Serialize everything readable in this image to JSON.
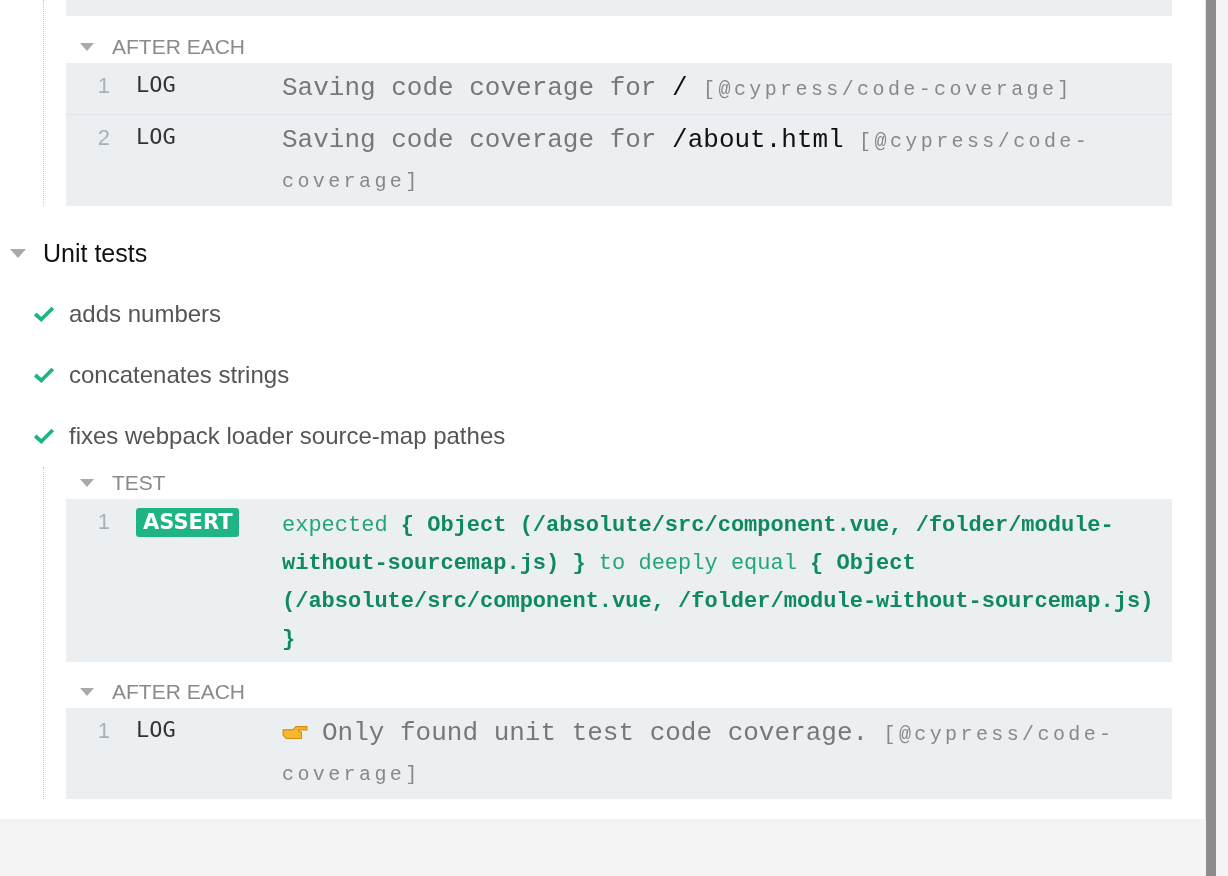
{
  "previous_test": {
    "hooks": [
      {
        "title": "AFTER EACH",
        "expanded": true,
        "commands": [
          {
            "number": "1",
            "name": "LOG",
            "kind": "log",
            "message": [
              {
                "kind": "text",
                "text": "Saving code coverage for "
              },
              {
                "kind": "value",
                "text": "/"
              },
              {
                "kind": "ref",
                "text": " [@cypress/code-coverage]"
              }
            ]
          },
          {
            "number": "2",
            "name": "LOG",
            "kind": "log",
            "message": [
              {
                "kind": "text",
                "text": "Saving code coverage for "
              },
              {
                "kind": "value",
                "text": "/about.html"
              },
              {
                "kind": "ref",
                "text": " [@cypress/code-coverage]"
              }
            ]
          }
        ]
      }
    ]
  },
  "suite": {
    "title": "Unit tests",
    "expanded": true,
    "tests": [
      {
        "title": "adds numbers",
        "passed": true
      },
      {
        "title": "concatenates strings",
        "passed": true
      },
      {
        "title": "fixes webpack loader source-map pathes",
        "passed": true,
        "hooks": [
          {
            "title": "TEST",
            "expanded": true,
            "commands": [
              {
                "number": "1",
                "name": "ASSERT",
                "kind": "assert",
                "message": [
                  {
                    "kind": "text",
                    "text": "expected "
                  },
                  {
                    "kind": "value",
                    "text": " { Object (/absolute/src/component.vue, /folder/module-without-sourcemap.js) } "
                  },
                  {
                    "kind": "text",
                    "text": " to deeply equal "
                  },
                  {
                    "kind": "value",
                    "text": " { Object (/absolute/src/component.vue, /folder/module-without-sourcemap.js) }"
                  }
                ]
              }
            ]
          },
          {
            "title": "AFTER EACH",
            "expanded": true,
            "commands": [
              {
                "number": "1",
                "name": "LOG",
                "kind": "log",
                "pointer": true,
                "message": [
                  {
                    "kind": "text",
                    "text": "Only found unit test code coverage."
                  },
                  {
                    "kind": "ref",
                    "text": " [@cypress/code-coverage]"
                  }
                ]
              }
            ]
          }
        ]
      }
    ]
  }
}
